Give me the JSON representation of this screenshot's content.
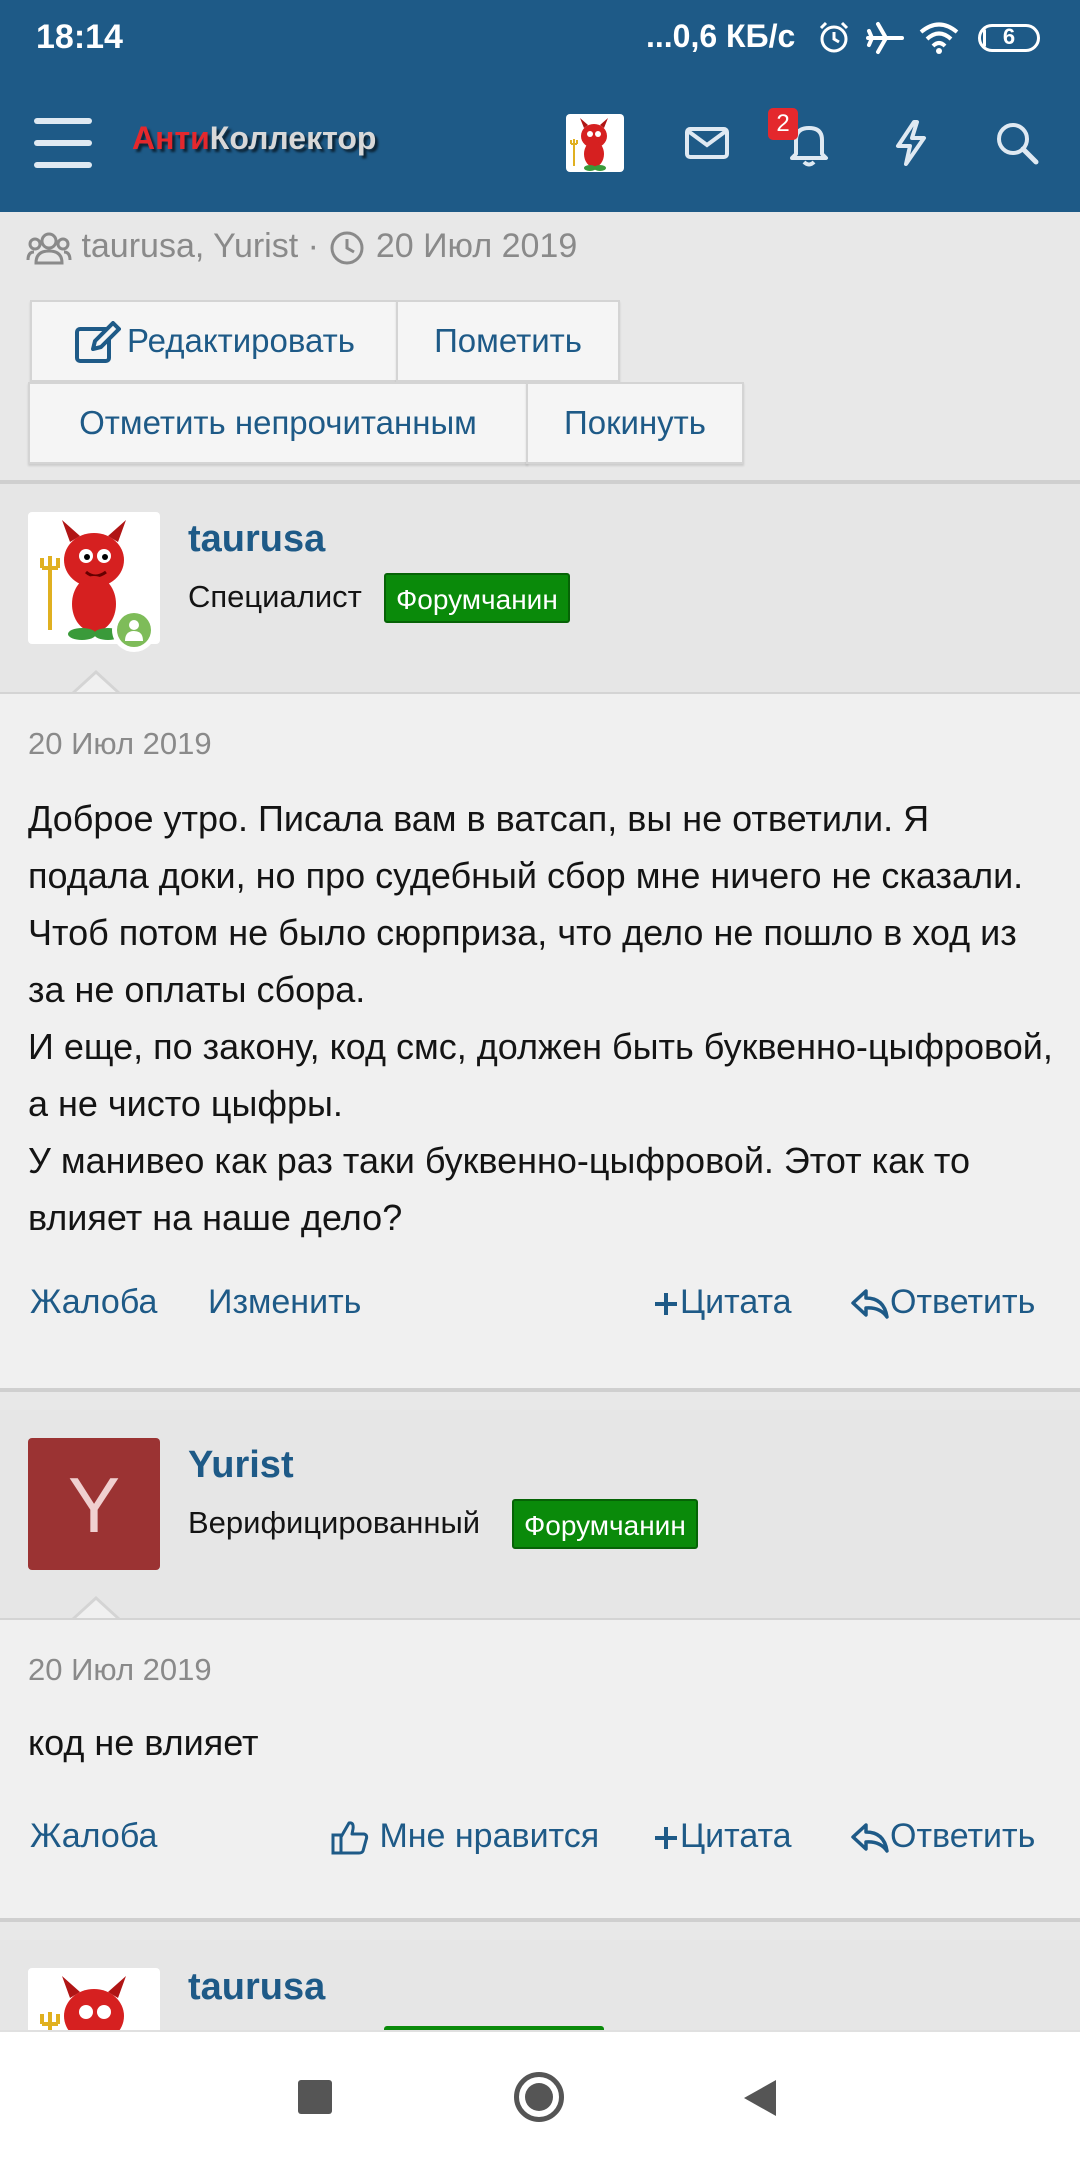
{
  "status_bar": {
    "time": "18:14",
    "network_speed": "...0,6 КБ/с",
    "battery_level": "6"
  },
  "header": {
    "logo_part1": "Анти",
    "logo_part2": "Коллектор",
    "alerts_count": "2"
  },
  "thread_meta": {
    "participants": "taurusa, Yurist",
    "separator": "·",
    "date": "20 Июл 2019"
  },
  "thread_buttons": {
    "edit": "Редактировать",
    "mark": "Пометить",
    "mark_unread": "Отметить непрочитанным",
    "leave": "Покинуть"
  },
  "messages": [
    {
      "author": "taurusa",
      "user_title": "Специалист",
      "user_badge": "Форумчанин",
      "date": "20 Июл 2019",
      "paragraphs": [
        "Доброе утро. Писала вам в ватсап, вы не ответили. Я подала доки, но про судебный сбор мне ничего не сказали. Чтоб потом не было сюрприза, что дело не пошло в ход из за не оплаты сбора.",
        "И еще, по закону, код смс, должен быть буквенно-цыфровой, а не чисто цыфры.",
        "У манивео как раз таки буквенно-цыфровой. Этот как то влияет на наше дело?"
      ],
      "actions": {
        "report": "Жалоба",
        "edit": "Изменить",
        "quote": "Цитата",
        "reply": "Ответить"
      }
    },
    {
      "author": "Yurist",
      "avatar_letter": "Y",
      "user_title": "Верифицированный",
      "user_badge": "Форумчанин",
      "date": "20 Июл 2019",
      "paragraphs": [
        "код не влияет"
      ],
      "actions": {
        "report": "Жалоба",
        "like": "Мне нравится",
        "quote": "Цитата",
        "reply": "Ответить"
      }
    },
    {
      "author": "taurusa"
    }
  ],
  "colors": {
    "header_bg": "#1e5a87",
    "link": "#1e5a87",
    "badge_green": "#0a8a0a",
    "yurist_avatar": "#9b3333"
  }
}
